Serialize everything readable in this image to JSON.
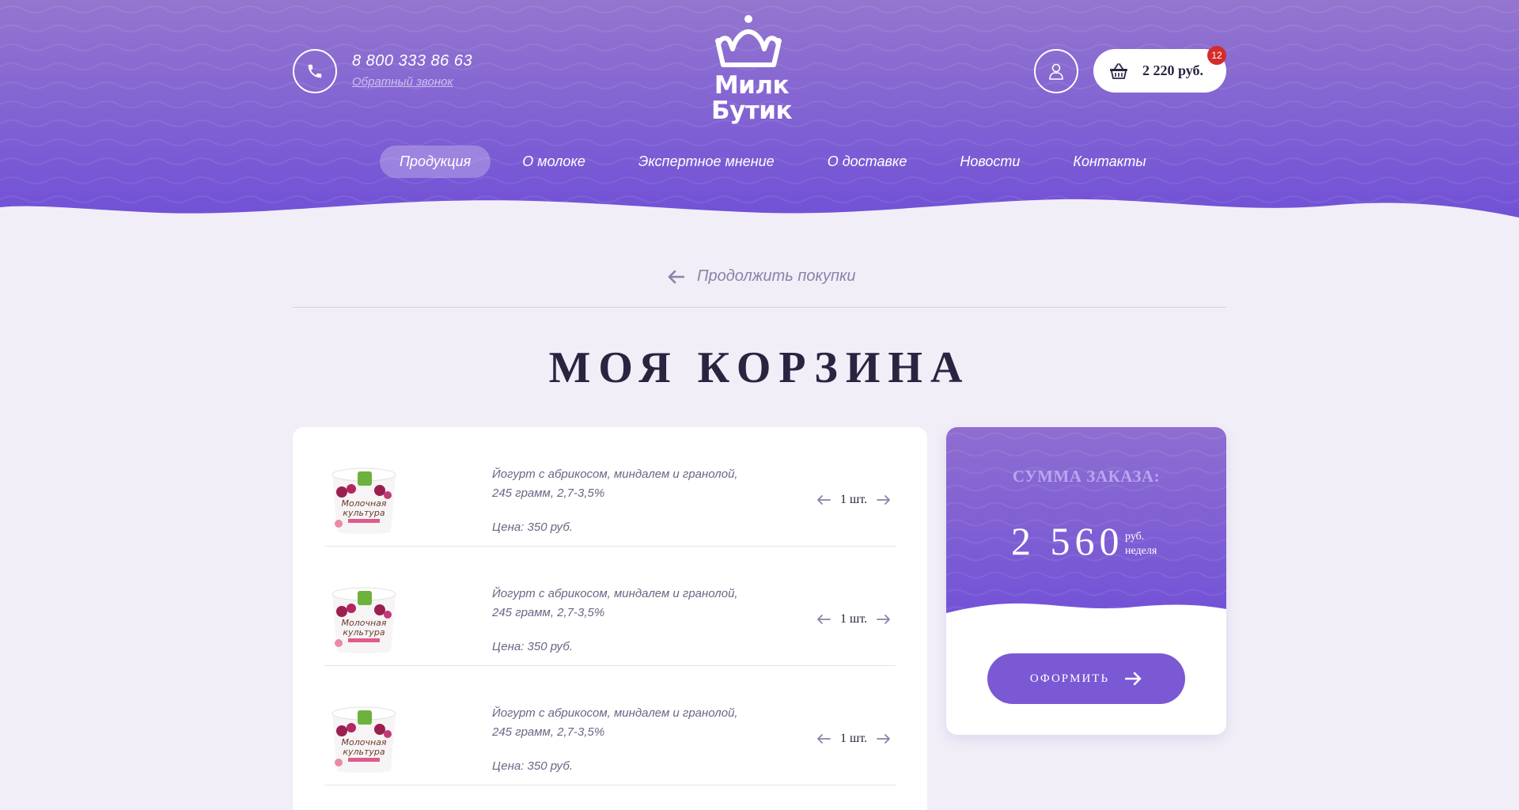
{
  "header": {
    "phone": "8 800 333 86 63",
    "callback_label": "Обратный звонок",
    "logo_line1": "Милк",
    "logo_line2": "Бутик",
    "cart_total": "2 220 руб.",
    "cart_count": "12"
  },
  "nav": {
    "items": [
      "Продукция",
      "О молоке",
      "Экспертное мнение",
      "О доставке",
      "Новости",
      "Контакты"
    ],
    "active_index": 0
  },
  "page": {
    "continue_label": "Продолжить покупки",
    "title": "МОЯ КОРЗИНА"
  },
  "cart_items": [
    {
      "name_line1": "Йогурт с абрикосом, миндалем и гранолой,",
      "name_line2": "245 грамм, 2,7-3,5%",
      "price": "Цена: 350 руб.",
      "qty": "1 шт."
    },
    {
      "name_line1": "Йогурт с абрикосом, миндалем и гранолой,",
      "name_line2": "245 грамм, 2,7-3,5%",
      "price": "Цена: 350 руб.",
      "qty": "1 шт."
    },
    {
      "name_line1": "Йогурт с абрикосом, миндалем и гранолой,",
      "name_line2": "245 грамм, 2,7-3,5%",
      "price": "Цена: 350 руб.",
      "qty": "1 шт."
    }
  ],
  "summary": {
    "label": "СУММА ЗАКАЗА:",
    "amount": "2 560",
    "unit_line1": "руб.",
    "unit_line2": "неделя",
    "checkout_label": "ОФОРМИТЬ"
  },
  "colors": {
    "brand_purple": "#7b58d4",
    "header_top": "#9476cf",
    "header_bottom": "#7151d6",
    "background": "#f1eef8",
    "badge_red": "#d42c2c"
  },
  "icons": [
    "phone-icon",
    "user-icon",
    "basket-icon",
    "arrow-left-icon",
    "arrow-right-icon",
    "crown-icon"
  ]
}
